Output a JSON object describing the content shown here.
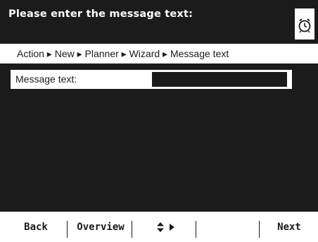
{
  "header": {
    "title": "Please enter the message text:",
    "icon": "timer-icon"
  },
  "breadcrumb": {
    "text": "Action ▸ New ▸ Planner ▸ Wizard ▸ Message text"
  },
  "form": {
    "message_label": "Message text:",
    "message_value": ""
  },
  "softkeys": {
    "back": "Back",
    "overview": "Overview",
    "nav_icons": [
      "up-down-arrows-icon",
      "right-arrow-icon"
    ],
    "blank": "",
    "next": "Next"
  },
  "colors": {
    "dark": "#1b1b1b",
    "light": "#ffffff"
  }
}
